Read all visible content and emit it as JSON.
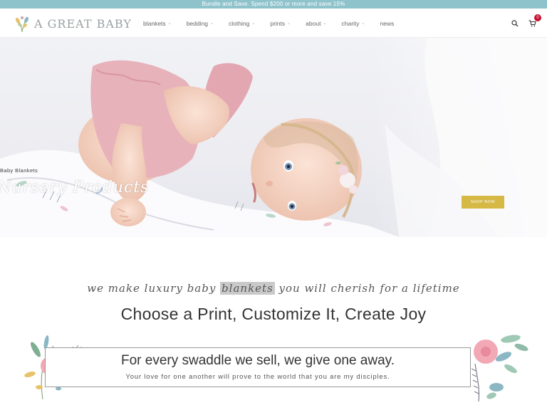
{
  "announcement": "Bundle and Save. Spend $200 or more and save 15%",
  "brand": {
    "name": "A GREAT BABY"
  },
  "nav": [
    {
      "label": "blankets",
      "dropdown": true
    },
    {
      "label": "bedding",
      "dropdown": true
    },
    {
      "label": "clothing",
      "dropdown": true
    },
    {
      "label": "prints",
      "dropdown": true
    },
    {
      "label": "about",
      "dropdown": true
    },
    {
      "label": "charity",
      "dropdown": true
    },
    {
      "label": "news",
      "dropdown": false
    }
  ],
  "header_icons": {
    "search": "search-icon",
    "cart": "cart-icon",
    "cart_count": "0"
  },
  "hero": {
    "eyebrow": "Baby Blankets",
    "title": "Nursery Products",
    "button": "SHOP NOW"
  },
  "tagline": {
    "before": "we make luxury baby ",
    "highlight": "blankets",
    "after": " you will cherish for a lifetime"
  },
  "heading": "Choose a Print, Customize It, Create Joy",
  "charity": {
    "title": "For every swaddle we sell, we give one away.",
    "subtitle": "Your love for one another will prove to the world that you are my disciples."
  },
  "colors": {
    "announcement_bg": "#8fc3cc",
    "button_bg": "#d6b844",
    "badge": "#c8102e"
  }
}
